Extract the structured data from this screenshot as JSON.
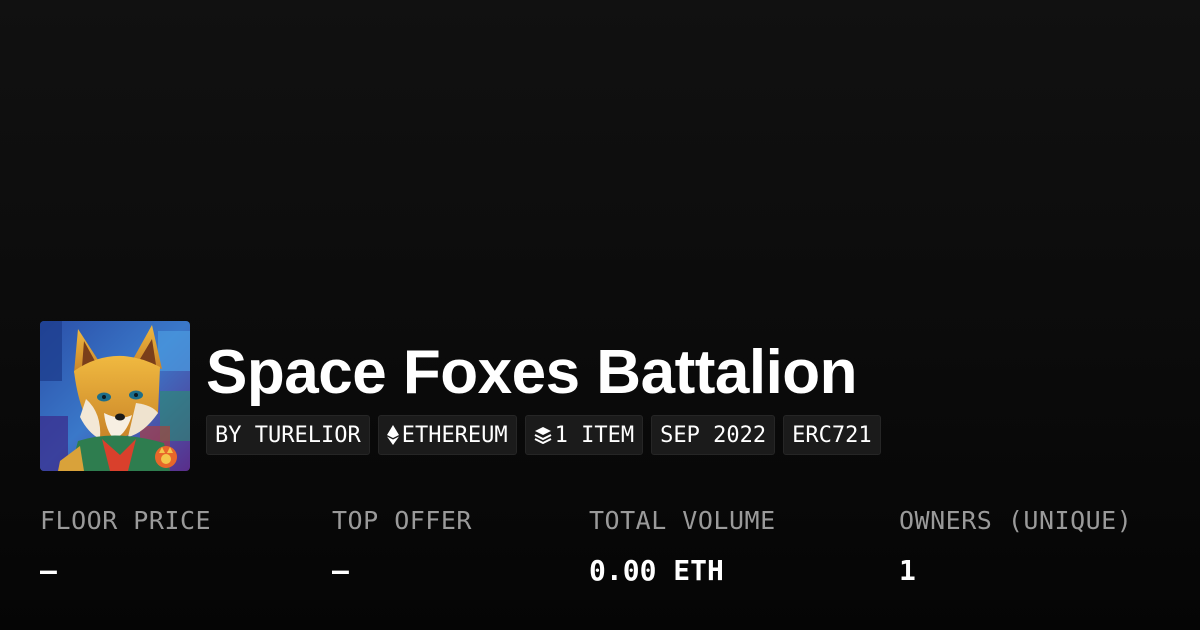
{
  "collection": {
    "name": "Space Foxes Battalion",
    "avatar_icon": "fox-portrait-avatar"
  },
  "chips": [
    {
      "label": "BY TURELIOR",
      "icon": ""
    },
    {
      "label": "ETHEREUM",
      "icon": "ethereum-icon"
    },
    {
      "label": "1 ITEM",
      "icon": "layers-icon"
    },
    {
      "label": "SEP 2022",
      "icon": ""
    },
    {
      "label": "ERC721",
      "icon": ""
    }
  ],
  "stats": [
    {
      "label": "FLOOR PRICE",
      "value": "–"
    },
    {
      "label": "TOP OFFER",
      "value": "–"
    },
    {
      "label": "TOTAL VOLUME",
      "value": "0.00 ETH"
    },
    {
      "label": "OWNERS (UNIQUE)",
      "value": "1"
    }
  ],
  "colors": {
    "background": "#0a0a0a",
    "chip_background": "#1b1b1b",
    "label_gray": "#9a9a9a",
    "text": "#ffffff"
  }
}
